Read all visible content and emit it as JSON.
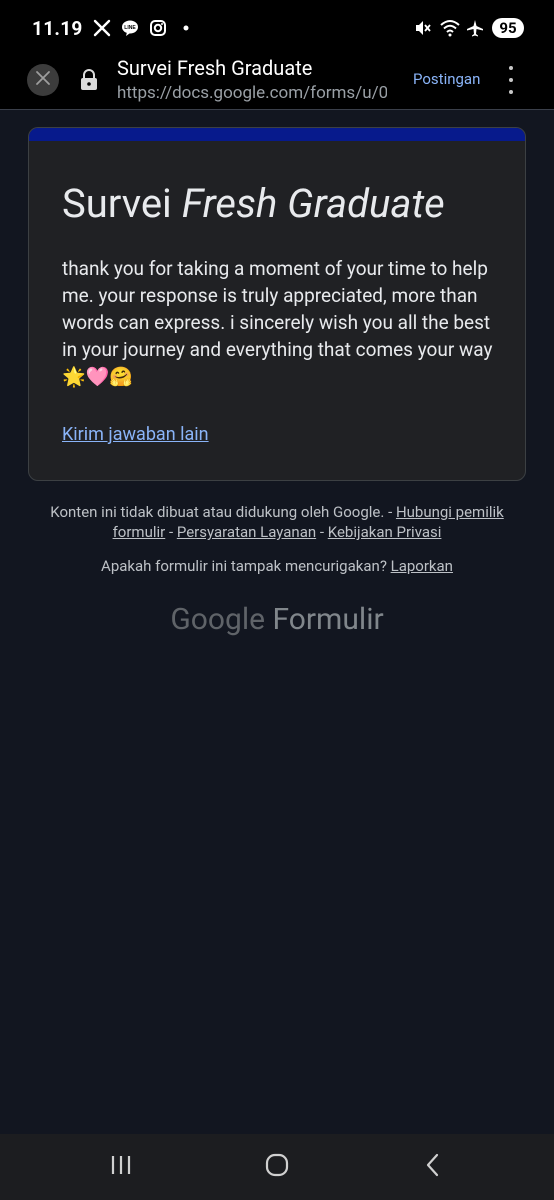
{
  "status_bar": {
    "time": "11.19",
    "battery": "95",
    "icons": [
      "x-icon",
      "line-icon",
      "instagram-icon",
      "dot-icon",
      "mute-icon",
      "wifi-icon",
      "airplane-icon"
    ]
  },
  "toolbar": {
    "page_title": "Survei Fresh Graduate",
    "url": "https://docs.google.com/forms/u/0/",
    "action_label": "Postingan"
  },
  "card": {
    "accent_color": "#071a8c",
    "title_plain": "Survei ",
    "title_italic": "Fresh Graduate",
    "message": "thank you for taking a moment of your time to help me. your response is truly appreciated, more than words can express. i sincerely wish you all the best in your journey and everything that comes your way 🌟🩷🤗",
    "link_label": "Kirim jawaban lain"
  },
  "footer": {
    "disclaimer_prefix": "Konten ini tidak dibuat atau didukung oleh Google. - ",
    "contact_owner": "Hubungi pemilik formulir",
    "sep1": " - ",
    "terms": "Persyaratan Layanan",
    "sep2": " - ",
    "privacy": "Kebijakan Privasi",
    "report_prefix": "Apakah formulir ini tampak mencurigakan? ",
    "report_link": "Laporkan",
    "logo_google": "Google",
    "logo_forms": "Formulir"
  },
  "navbar": {
    "icons": [
      "recent-apps-icon",
      "home-icon",
      "back-icon"
    ]
  }
}
